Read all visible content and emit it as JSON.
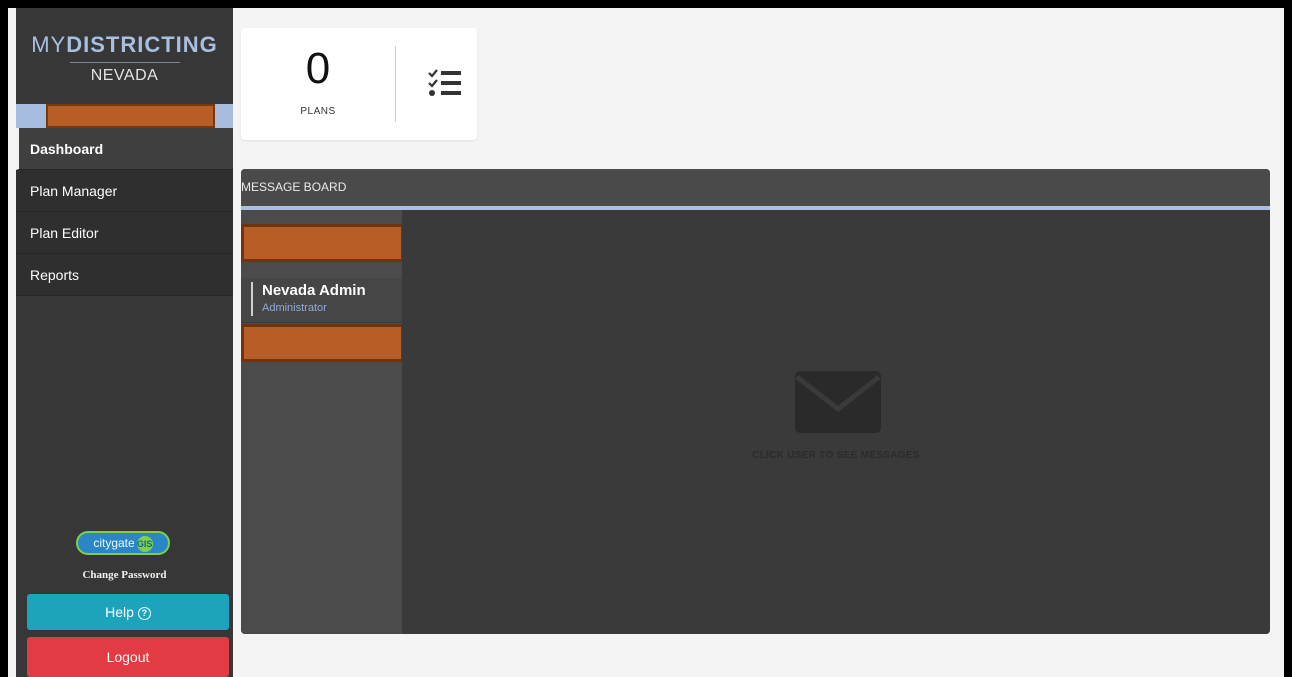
{
  "brand": {
    "prefix": "MY",
    "strong": "DISTRICTING",
    "subtitle": "NEVADA"
  },
  "sidebar": {
    "items": [
      {
        "label": "Dashboard",
        "active": true
      },
      {
        "label": "Plan Manager"
      },
      {
        "label": "Plan Editor"
      },
      {
        "label": "Reports"
      }
    ],
    "logo_text": "citygate",
    "logo_badge": "GIS",
    "change_password": "Change Password",
    "help": "Help",
    "help_icon": "?",
    "logout": "Logout"
  },
  "plans": {
    "count": "0",
    "label": "PLANS"
  },
  "message_board": {
    "title": "MESSAGE BOARD",
    "user": {
      "name": "Nevada Admin",
      "role": "Administrator"
    },
    "empty_text": "CLICK USER TO SEE MESSAGES"
  },
  "colors": {
    "accent": "#a9bee0",
    "help": "#1ea3bd",
    "logout": "#e23b44",
    "redaction": "#b75d28"
  }
}
